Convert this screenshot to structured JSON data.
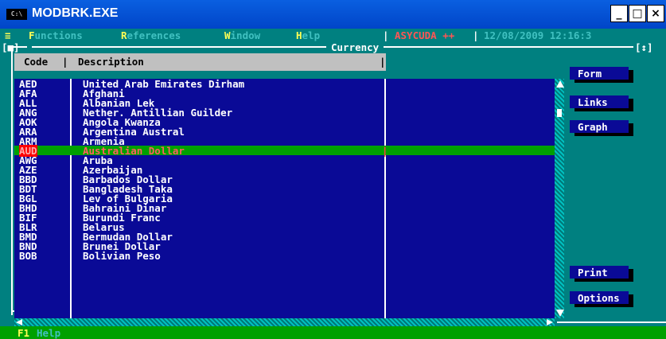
{
  "window": {
    "title": "MODBRK.EXE",
    "icon": "C:\\",
    "minimize": "_",
    "maximize": "□",
    "close": "×"
  },
  "menu": {
    "system": "≡",
    "items": [
      {
        "hot": "F",
        "rest": "unctions"
      },
      {
        "hot": "R",
        "rest": "eferences"
      },
      {
        "hot": "W",
        "rest": "indow"
      },
      {
        "hot": "H",
        "rest": "elp"
      }
    ],
    "app": "ASYCUDA ++",
    "datetime": "12/08/2009 12:16:3"
  },
  "panel": {
    "title": "Currency",
    "left_marker": "[■]",
    "right_marker": "[↕]"
  },
  "columns": {
    "code": "Code",
    "description": "Description"
  },
  "rows": [
    {
      "code": "AED",
      "desc": "United Arab Emirates Dirham"
    },
    {
      "code": "AFA",
      "desc": "Afghani"
    },
    {
      "code": "ALL",
      "desc": "Albanian Lek"
    },
    {
      "code": "ANG",
      "desc": "Nether. Antillian Guilder"
    },
    {
      "code": "AOK",
      "desc": "Angola Kwanza"
    },
    {
      "code": "ARA",
      "desc": "Argentina Austral"
    },
    {
      "code": "ARM",
      "desc": "Armenia"
    },
    {
      "code": "AUD",
      "desc": "Australian Dollar",
      "selected": true
    },
    {
      "code": "AWG",
      "desc": "Aruba"
    },
    {
      "code": "AZE",
      "desc": "Azerbaijan"
    },
    {
      "code": "BBD",
      "desc": "Barbados Dollar"
    },
    {
      "code": "BDT",
      "desc": "Bangladesh Taka"
    },
    {
      "code": "BGL",
      "desc": "Lev of Bulgaria"
    },
    {
      "code": "BHD",
      "desc": "Bahraini Dinar"
    },
    {
      "code": "BIF",
      "desc": "Burundi Franc"
    },
    {
      "code": "BLR",
      "desc": "Belarus"
    },
    {
      "code": "BMD",
      "desc": "Bermudan Dollar"
    },
    {
      "code": "BND",
      "desc": "Brunei Dollar"
    },
    {
      "code": "BOB",
      "desc": "Bolivian Peso"
    }
  ],
  "buttons": {
    "form": {
      "hot": "",
      "label": "Form"
    },
    "links": {
      "hot": "",
      "label": "Links"
    },
    "graph": {
      "hot": "G",
      "label": "raph"
    },
    "print": {
      "hot": "",
      "label": "Print"
    },
    "options": {
      "hot": "O",
      "label": "ptions"
    }
  },
  "status": {
    "key": "F1",
    "label": "Help"
  },
  "colors": {
    "teal": "#008080",
    "navy": "#0a0a96",
    "selected": "#00a000",
    "highlight": "#ffff55",
    "selected_code": "#ff4040"
  }
}
